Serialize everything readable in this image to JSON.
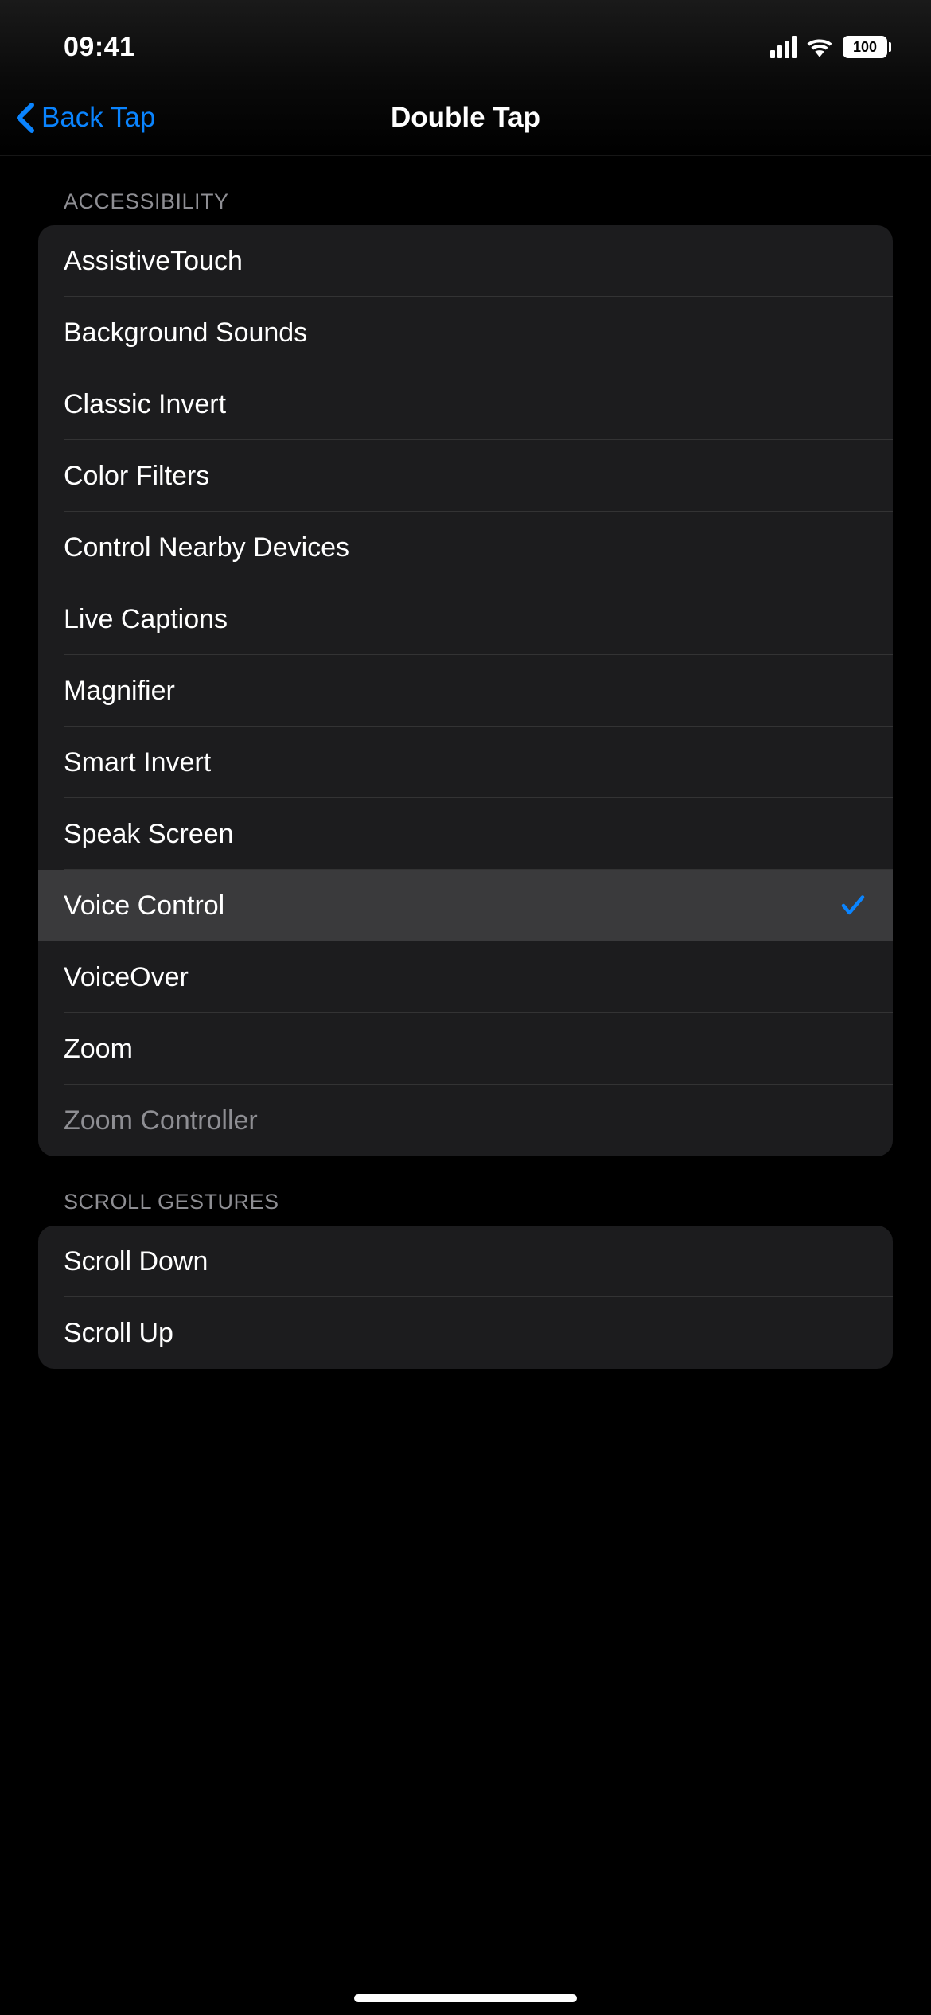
{
  "status_bar": {
    "time": "09:41",
    "battery": "100"
  },
  "nav": {
    "back_label": "Back Tap",
    "title": "Double Tap"
  },
  "sections": {
    "accessibility": {
      "header": "ACCESSIBILITY",
      "items": [
        {
          "label": "AssistiveTouch",
          "selected": false,
          "disabled": false
        },
        {
          "label": "Background Sounds",
          "selected": false,
          "disabled": false
        },
        {
          "label": "Classic Invert",
          "selected": false,
          "disabled": false
        },
        {
          "label": "Color Filters",
          "selected": false,
          "disabled": false
        },
        {
          "label": "Control Nearby Devices",
          "selected": false,
          "disabled": false
        },
        {
          "label": "Live Captions",
          "selected": false,
          "disabled": false
        },
        {
          "label": "Magnifier",
          "selected": false,
          "disabled": false
        },
        {
          "label": "Smart Invert",
          "selected": false,
          "disabled": false
        },
        {
          "label": "Speak Screen",
          "selected": false,
          "disabled": false
        },
        {
          "label": "Voice Control",
          "selected": true,
          "disabled": false
        },
        {
          "label": "VoiceOver",
          "selected": false,
          "disabled": false
        },
        {
          "label": "Zoom",
          "selected": false,
          "disabled": false
        },
        {
          "label": "Zoom Controller",
          "selected": false,
          "disabled": true
        }
      ]
    },
    "scroll_gestures": {
      "header": "SCROLL GESTURES",
      "items": [
        {
          "label": "Scroll Down",
          "selected": false,
          "disabled": false
        },
        {
          "label": "Scroll Up",
          "selected": false,
          "disabled": false
        }
      ]
    }
  }
}
